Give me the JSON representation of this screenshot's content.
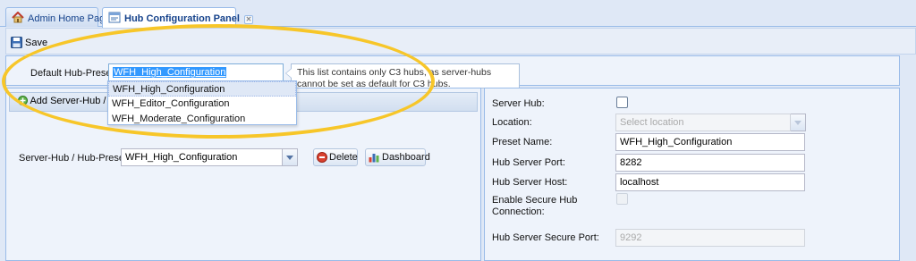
{
  "tabs": [
    {
      "label": "Admin Home Page",
      "icon": "home-icon",
      "active": false
    },
    {
      "label": "Hub Configuration Panel",
      "icon": "panel-icon",
      "active": true
    }
  ],
  "toolbar": {
    "save_label": "Save",
    "save_icon": "floppy-disk-icon"
  },
  "default_preset": {
    "label": "Default Hub-Preset :",
    "value": "WFH_High_Configuration",
    "tooltip": "This list contains only C3 hubs, as server-hubs cannot be set as default for C3 hubs.",
    "options": [
      "WFH_High_Configuration",
      "WFH_Editor_Configuration",
      "WFH_Moderate_Configuration"
    ]
  },
  "left_panel": {
    "add_label": "Add Server-Hub / Hub",
    "add_icon": "add-icon",
    "server_hub_label": "Server-Hub / Hub-Preset :",
    "server_hub_value": "WFH_High_Configuration",
    "delete_label": "Delete",
    "delete_icon": "delete-icon",
    "dashboard_label": "Dashboard",
    "dashboard_icon": "dashboard-icon"
  },
  "right_panel": {
    "server_hub_label": "Server Hub:",
    "server_hub_checked": false,
    "location_label": "Location:",
    "location_placeholder": "Select location",
    "preset_name_label": "Preset Name:",
    "preset_name_value": "WFH_High_Configuration",
    "port_label": "Hub Server Port:",
    "port_value": "8282",
    "host_label": "Hub Server Host:",
    "host_value": "localhost",
    "secure_label": "Enable Secure Hub Connection:",
    "secure_checked": false,
    "secure_port_label": "Hub Server Secure Port:",
    "secure_port_value": "9292"
  },
  "colors": {
    "accent": "#15428b",
    "highlight_ring": "#f7c629",
    "selection": "#3399ff",
    "panel_bg": "#eef3fb",
    "border": "#99bbe8"
  }
}
